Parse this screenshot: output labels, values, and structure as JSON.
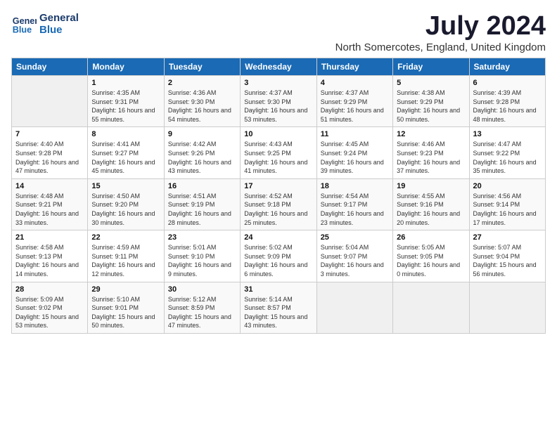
{
  "logo": {
    "line1": "General",
    "line2": "Blue"
  },
  "title": "July 2024",
  "location": "North Somercotes, England, United Kingdom",
  "headers": [
    "Sunday",
    "Monday",
    "Tuesday",
    "Wednesday",
    "Thursday",
    "Friday",
    "Saturday"
  ],
  "weeks": [
    [
      {
        "day": "",
        "sunrise": "",
        "sunset": "",
        "daylight": ""
      },
      {
        "day": "1",
        "sunrise": "Sunrise: 4:35 AM",
        "sunset": "Sunset: 9:31 PM",
        "daylight": "Daylight: 16 hours and 55 minutes."
      },
      {
        "day": "2",
        "sunrise": "Sunrise: 4:36 AM",
        "sunset": "Sunset: 9:30 PM",
        "daylight": "Daylight: 16 hours and 54 minutes."
      },
      {
        "day": "3",
        "sunrise": "Sunrise: 4:37 AM",
        "sunset": "Sunset: 9:30 PM",
        "daylight": "Daylight: 16 hours and 53 minutes."
      },
      {
        "day": "4",
        "sunrise": "Sunrise: 4:37 AM",
        "sunset": "Sunset: 9:29 PM",
        "daylight": "Daylight: 16 hours and 51 minutes."
      },
      {
        "day": "5",
        "sunrise": "Sunrise: 4:38 AM",
        "sunset": "Sunset: 9:29 PM",
        "daylight": "Daylight: 16 hours and 50 minutes."
      },
      {
        "day": "6",
        "sunrise": "Sunrise: 4:39 AM",
        "sunset": "Sunset: 9:28 PM",
        "daylight": "Daylight: 16 hours and 48 minutes."
      }
    ],
    [
      {
        "day": "7",
        "sunrise": "Sunrise: 4:40 AM",
        "sunset": "Sunset: 9:28 PM",
        "daylight": "Daylight: 16 hours and 47 minutes."
      },
      {
        "day": "8",
        "sunrise": "Sunrise: 4:41 AM",
        "sunset": "Sunset: 9:27 PM",
        "daylight": "Daylight: 16 hours and 45 minutes."
      },
      {
        "day": "9",
        "sunrise": "Sunrise: 4:42 AM",
        "sunset": "Sunset: 9:26 PM",
        "daylight": "Daylight: 16 hours and 43 minutes."
      },
      {
        "day": "10",
        "sunrise": "Sunrise: 4:43 AM",
        "sunset": "Sunset: 9:25 PM",
        "daylight": "Daylight: 16 hours and 41 minutes."
      },
      {
        "day": "11",
        "sunrise": "Sunrise: 4:45 AM",
        "sunset": "Sunset: 9:24 PM",
        "daylight": "Daylight: 16 hours and 39 minutes."
      },
      {
        "day": "12",
        "sunrise": "Sunrise: 4:46 AM",
        "sunset": "Sunset: 9:23 PM",
        "daylight": "Daylight: 16 hours and 37 minutes."
      },
      {
        "day": "13",
        "sunrise": "Sunrise: 4:47 AM",
        "sunset": "Sunset: 9:22 PM",
        "daylight": "Daylight: 16 hours and 35 minutes."
      }
    ],
    [
      {
        "day": "14",
        "sunrise": "Sunrise: 4:48 AM",
        "sunset": "Sunset: 9:21 PM",
        "daylight": "Daylight: 16 hours and 33 minutes."
      },
      {
        "day": "15",
        "sunrise": "Sunrise: 4:50 AM",
        "sunset": "Sunset: 9:20 PM",
        "daylight": "Daylight: 16 hours and 30 minutes."
      },
      {
        "day": "16",
        "sunrise": "Sunrise: 4:51 AM",
        "sunset": "Sunset: 9:19 PM",
        "daylight": "Daylight: 16 hours and 28 minutes."
      },
      {
        "day": "17",
        "sunrise": "Sunrise: 4:52 AM",
        "sunset": "Sunset: 9:18 PM",
        "daylight": "Daylight: 16 hours and 25 minutes."
      },
      {
        "day": "18",
        "sunrise": "Sunrise: 4:54 AM",
        "sunset": "Sunset: 9:17 PM",
        "daylight": "Daylight: 16 hours and 23 minutes."
      },
      {
        "day": "19",
        "sunrise": "Sunrise: 4:55 AM",
        "sunset": "Sunset: 9:16 PM",
        "daylight": "Daylight: 16 hours and 20 minutes."
      },
      {
        "day": "20",
        "sunrise": "Sunrise: 4:56 AM",
        "sunset": "Sunset: 9:14 PM",
        "daylight": "Daylight: 16 hours and 17 minutes."
      }
    ],
    [
      {
        "day": "21",
        "sunrise": "Sunrise: 4:58 AM",
        "sunset": "Sunset: 9:13 PM",
        "daylight": "Daylight: 16 hours and 14 minutes."
      },
      {
        "day": "22",
        "sunrise": "Sunrise: 4:59 AM",
        "sunset": "Sunset: 9:11 PM",
        "daylight": "Daylight: 16 hours and 12 minutes."
      },
      {
        "day": "23",
        "sunrise": "Sunrise: 5:01 AM",
        "sunset": "Sunset: 9:10 PM",
        "daylight": "Daylight: 16 hours and 9 minutes."
      },
      {
        "day": "24",
        "sunrise": "Sunrise: 5:02 AM",
        "sunset": "Sunset: 9:09 PM",
        "daylight": "Daylight: 16 hours and 6 minutes."
      },
      {
        "day": "25",
        "sunrise": "Sunrise: 5:04 AM",
        "sunset": "Sunset: 9:07 PM",
        "daylight": "Daylight: 16 hours and 3 minutes."
      },
      {
        "day": "26",
        "sunrise": "Sunrise: 5:05 AM",
        "sunset": "Sunset: 9:05 PM",
        "daylight": "Daylight: 16 hours and 0 minutes."
      },
      {
        "day": "27",
        "sunrise": "Sunrise: 5:07 AM",
        "sunset": "Sunset: 9:04 PM",
        "daylight": "Daylight: 15 hours and 56 minutes."
      }
    ],
    [
      {
        "day": "28",
        "sunrise": "Sunrise: 5:09 AM",
        "sunset": "Sunset: 9:02 PM",
        "daylight": "Daylight: 15 hours and 53 minutes."
      },
      {
        "day": "29",
        "sunrise": "Sunrise: 5:10 AM",
        "sunset": "Sunset: 9:01 PM",
        "daylight": "Daylight: 15 hours and 50 minutes."
      },
      {
        "day": "30",
        "sunrise": "Sunrise: 5:12 AM",
        "sunset": "Sunset: 8:59 PM",
        "daylight": "Daylight: 15 hours and 47 minutes."
      },
      {
        "day": "31",
        "sunrise": "Sunrise: 5:14 AM",
        "sunset": "Sunset: 8:57 PM",
        "daylight": "Daylight: 15 hours and 43 minutes."
      },
      {
        "day": "",
        "sunrise": "",
        "sunset": "",
        "daylight": ""
      },
      {
        "day": "",
        "sunrise": "",
        "sunset": "",
        "daylight": ""
      },
      {
        "day": "",
        "sunrise": "",
        "sunset": "",
        "daylight": ""
      }
    ]
  ]
}
